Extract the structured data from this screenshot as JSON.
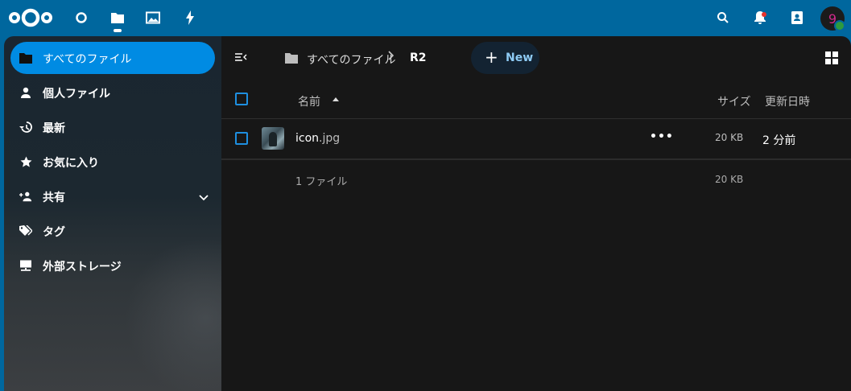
{
  "header": {
    "apps": [
      "dashboard-icon",
      "files-icon",
      "photos-icon",
      "activity-icon"
    ],
    "right_icons": [
      "search-icon",
      "notifications-icon",
      "contacts-icon"
    ],
    "avatar_initial": "9"
  },
  "sidebar": {
    "items": [
      {
        "label": "すべてのファイル",
        "icon": "folder-icon",
        "active": true
      },
      {
        "label": "個人ファイル",
        "icon": "person-icon"
      },
      {
        "label": "最新",
        "icon": "history-icon"
      },
      {
        "label": "お気に入り",
        "icon": "star-icon"
      },
      {
        "label": "共有",
        "icon": "share-icon",
        "expandable": true
      },
      {
        "label": "タグ",
        "icon": "tag-icon"
      },
      {
        "label": "外部ストレージ",
        "icon": "external-storage-icon"
      }
    ]
  },
  "breadcrumb": {
    "root": "すべてのファイル",
    "current": "R2"
  },
  "toolbar": {
    "new_label": "New"
  },
  "table": {
    "headers": {
      "name": "名前",
      "size": "サイズ",
      "modified": "更新日時"
    },
    "rows": [
      {
        "name": "icon",
        "ext": ".jpg",
        "size": "20 KB",
        "modified": "2 分前"
      }
    ],
    "footer": {
      "count": "1 ファイル",
      "size": "20 KB"
    }
  },
  "colors": {
    "header_bg": "#00679e",
    "accent": "#008be3",
    "main_bg": "#171717"
  }
}
